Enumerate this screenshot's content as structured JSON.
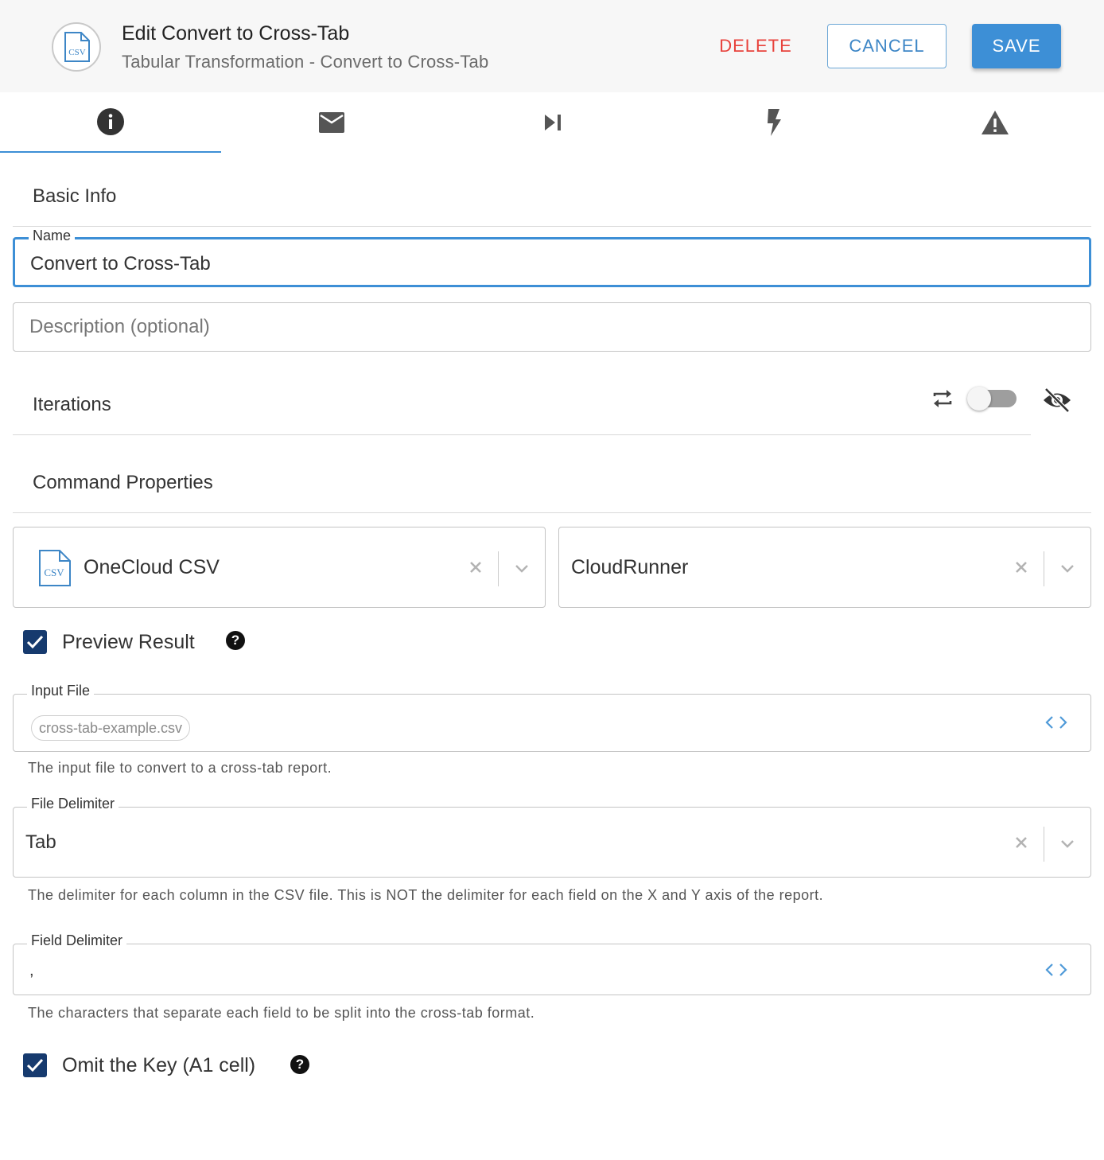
{
  "header": {
    "title": "Edit Convert to Cross-Tab",
    "subtitle": "Tabular Transformation - Convert to Cross-Tab",
    "logo_text": "CSV",
    "delete_label": "DELETE",
    "cancel_label": "CANCEL",
    "save_label": "SAVE"
  },
  "tabs": [
    {
      "icon": "info-icon",
      "active": true
    },
    {
      "icon": "email-icon",
      "active": false
    },
    {
      "icon": "skip-next-icon",
      "active": false
    },
    {
      "icon": "lightning-icon",
      "active": false
    },
    {
      "icon": "warning-icon",
      "active": false
    }
  ],
  "basic_info": {
    "title": "Basic Info",
    "name_label": "Name",
    "name_value": "Convert to Cross-Tab",
    "description_placeholder": "Description (optional)"
  },
  "iterations": {
    "title": "Iterations",
    "toggle_on": false
  },
  "command_properties": {
    "title": "Command Properties",
    "connection": "OneCloud CSV",
    "connection_icon_text": "CSV",
    "runner": "CloudRunner",
    "preview_result": {
      "label": "Preview Result",
      "checked": true
    },
    "input_file": {
      "label": "Input File",
      "value": "cross-tab-example.csv",
      "hint": "The input file to convert to a cross-tab report."
    },
    "file_delimiter": {
      "label": "File Delimiter",
      "value": "Tab",
      "hint": "The delimiter for each column in the CSV file. This is NOT the delimiter for each field on the X and Y axis of the report."
    },
    "field_delimiter": {
      "label": "Field Delimiter",
      "value": ",",
      "hint": "The characters that separate each field to be split into the cross-tab format."
    },
    "omit_key": {
      "label": "Omit the Key (A1 cell)",
      "checked": true
    },
    "help_glyph": "?"
  },
  "colors": {
    "accent": "#3d8fd6",
    "delete": "#e8423c",
    "checkbox": "#163a6e"
  }
}
